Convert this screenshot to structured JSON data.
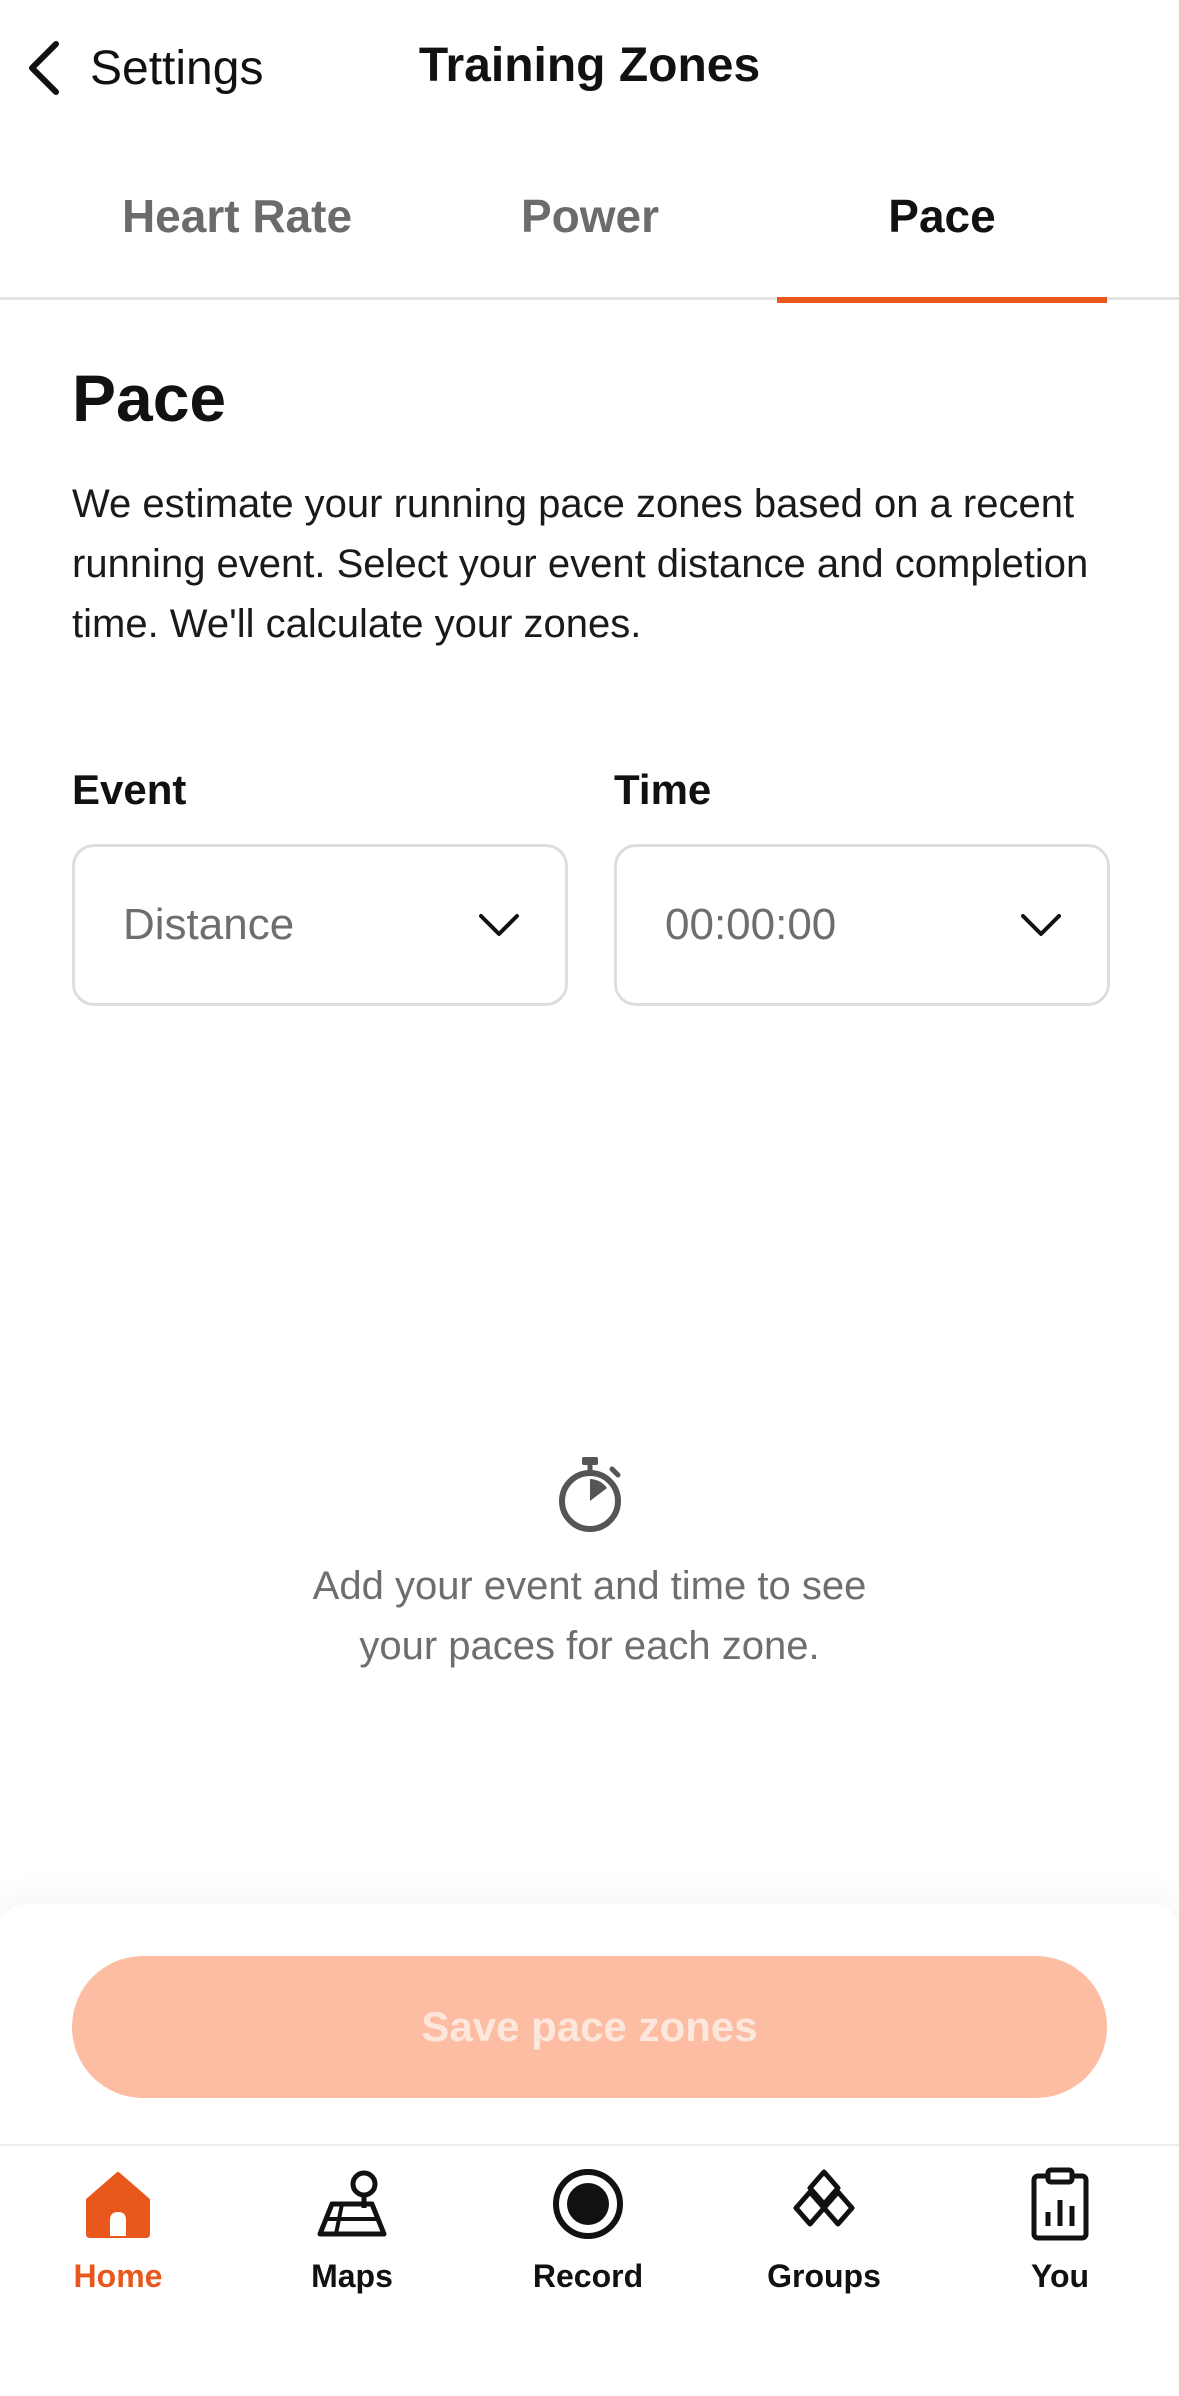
{
  "header": {
    "back_label": "Settings",
    "title": "Training Zones"
  },
  "tabs": [
    {
      "label": "Heart Rate",
      "active": false
    },
    {
      "label": "Power",
      "active": false
    },
    {
      "label": "Pace",
      "active": true
    }
  ],
  "content": {
    "title": "Pace",
    "description": "We estimate your running pace zones based on a recent running event. Select your event distance and completion time. We'll calculate your zones.",
    "event": {
      "label": "Event",
      "placeholder": "Distance"
    },
    "time": {
      "label": "Time",
      "placeholder": "00:00:00"
    },
    "empty_state": "Add your event and time to see your paces for each zone."
  },
  "footer": {
    "save_label": "Save pace zones"
  },
  "nav": [
    {
      "label": "Home",
      "icon": "home-icon",
      "active": true
    },
    {
      "label": "Maps",
      "icon": "map-icon",
      "active": false
    },
    {
      "label": "Record",
      "icon": "record-icon",
      "active": false
    },
    {
      "label": "Groups",
      "icon": "groups-icon",
      "active": false
    },
    {
      "label": "You",
      "icon": "clipboard-chart-icon",
      "active": false
    }
  ],
  "colors": {
    "accent": "#e8581c",
    "button_disabled": "#fcbda3",
    "text_secondary": "#6e6e6e"
  }
}
